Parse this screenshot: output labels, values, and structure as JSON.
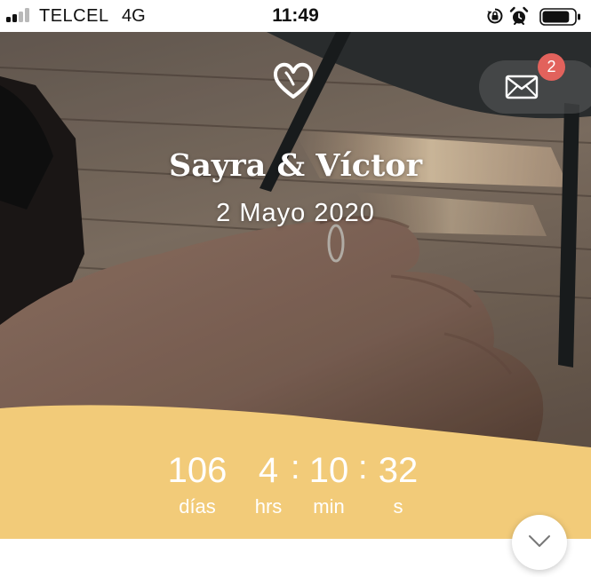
{
  "status_bar": {
    "carrier": "TELCEL",
    "network": "4G",
    "time": "11:49",
    "signal_bars_active": 2,
    "signal_bars_total": 4,
    "battery_level": 0.85
  },
  "header": {
    "couple_names": "Sayra & Víctor",
    "date": "2 Mayo 2020",
    "messages_badge": "2"
  },
  "countdown": {
    "days": "106",
    "days_label": "días",
    "hours": "4",
    "hours_label": "hrs",
    "minutes": "10",
    "minutes_label": "min",
    "seconds": "32",
    "seconds_label": "s",
    "separator": ":"
  },
  "colors": {
    "accent_yellow": "#f2cb79",
    "badge_red": "#e2625c",
    "text_white": "#ffffff"
  },
  "icons": [
    "signal-icon",
    "rotation-lock-icon",
    "alarm-icon",
    "battery-icon",
    "heart-icon",
    "mail-icon",
    "chevron-down-icon"
  ]
}
